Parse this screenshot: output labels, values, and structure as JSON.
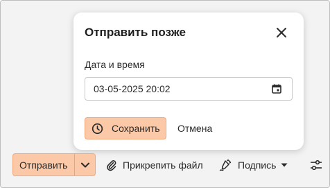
{
  "dialog": {
    "title": "Отправить позже",
    "close_icon": "close-icon",
    "field_label": "Дата и время",
    "datetime_value": "03-05-2025 20:02",
    "calendar_icon": "calendar-icon",
    "save_label": "Сохранить",
    "save_icon": "clock-icon",
    "cancel_label": "Отмена"
  },
  "toolbar": {
    "send_label": "Отправить",
    "send_caret_icon": "chevron-down-icon",
    "attach_label": "Прикрепить файл",
    "attach_icon": "paperclip-icon",
    "signature_label": "Подпись",
    "signature_icon": "pen-icon",
    "settings_icon": "sliders-icon"
  },
  "colors": {
    "accent_fill": "#fbc9a8",
    "accent_border": "#f3a67a",
    "text": "#2a2a2a",
    "background": "#f3f3f3"
  }
}
